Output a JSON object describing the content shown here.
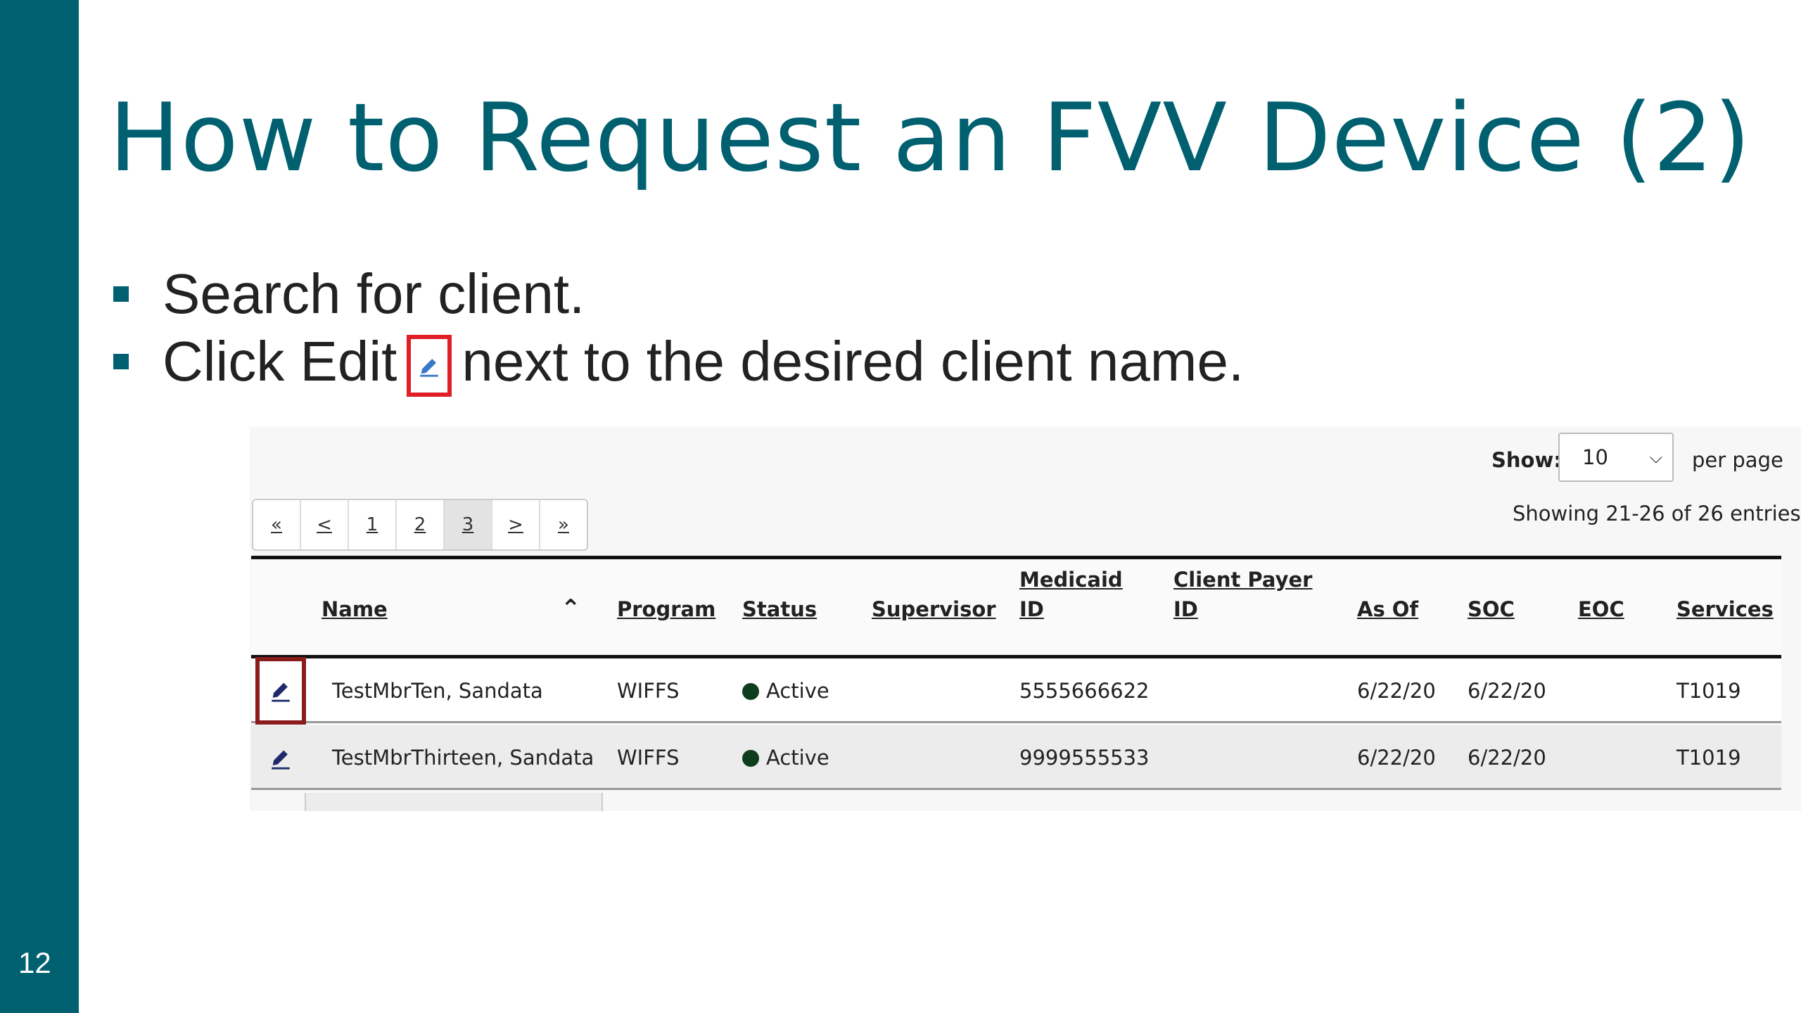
{
  "slide": {
    "number": "12",
    "title": "How to Request an FVV Device (2)",
    "accent_color": "#006070",
    "bullets": [
      {
        "text": "Search for client."
      },
      {
        "before": "Click Edit",
        "icon": "pencil-icon",
        "after": "next to the desired client name."
      }
    ]
  },
  "screenshot": {
    "show_label": "Show:",
    "per_page_value": "10",
    "per_page_label": "per page",
    "showing_text": "Showing 21-26 of 26 entries",
    "pagination": [
      "«",
      "<",
      "1",
      "2",
      "3",
      ">",
      "»"
    ],
    "active_page": "3",
    "columns": [
      "Name",
      "Program",
      "Status",
      "Supervisor",
      "Medicaid ID",
      "Client Payer ID",
      "As Of",
      "SOC",
      "EOC",
      "Services"
    ],
    "sort_icon": "chevron-up-icon",
    "rows": [
      {
        "name": "TestMbrTen, Sandata",
        "program": "WIFFS",
        "status": "Active",
        "supervisor": "",
        "medicaid_id": "5555666622",
        "client_payer_id": "",
        "as_of": "6/22/20",
        "soc": "6/22/20",
        "eoc": "",
        "services": "T1019"
      },
      {
        "name": "TestMbrThirteen, Sandata",
        "program": "WIFFS",
        "status": "Active",
        "supervisor": "",
        "medicaid_id": "9999555533",
        "client_payer_id": "",
        "as_of": "6/22/20",
        "soc": "6/22/20",
        "eoc": "",
        "services": "T1019"
      }
    ],
    "highlight_color": "#8b1c1c",
    "status_color": "#0d3d1a"
  }
}
